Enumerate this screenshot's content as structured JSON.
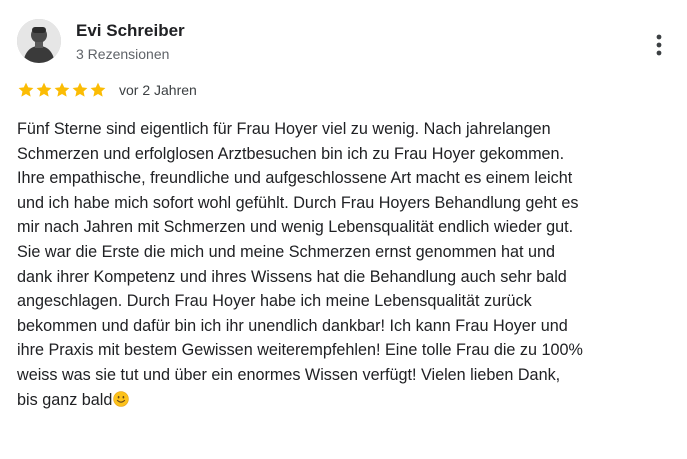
{
  "reviewer": {
    "name": "Evi Schreiber",
    "review_count": "3 Rezensionen",
    "avatar_icon": "person-avatar-icon"
  },
  "menu": {
    "icon": "more-vertical-icon"
  },
  "rating": {
    "stars": 5,
    "max_stars": 5,
    "star_color": "#fbbc04",
    "date": "vor 2 Jahren"
  },
  "review": {
    "lines": [
      "Fünf Sterne sind eigentlich für Frau Hoyer viel zu wenig. Nach jahrelangen",
      "Schmerzen und erfolglosen Arztbesuchen bin ich zu Frau Hoyer gekommen.",
      "Ihre empathische, freundliche und aufgeschlossene Art macht es einem leicht",
      "und ich habe mich sofort wohl gefühlt. Durch Frau Hoyers Behandlung geht es",
      "mir nach Jahren mit Schmerzen und wenig Lebensqualität endlich wieder gut.",
      "Sie war die Erste die mich und meine Schmerzen ernst genommen hat und",
      "dank ihrer Kompetenz und ihres Wissens hat die Behandlung auch sehr bald",
      "angeschlagen. Durch Frau Hoyer habe ich meine Lebensqualität zurück",
      "bekommen und dafür bin ich ihr unendlich dankbar! Ich kann Frau Hoyer und",
      "ihre Praxis mit bestem Gewissen weiterempfehlen! Eine tolle Frau die zu 100%",
      "weiss was sie tut und über ein enormes Wissen verfügt! Vielen lieben Dank,",
      "bis ganz bald"
    ],
    "trailing_emoji": "smiling-face-emoji"
  }
}
